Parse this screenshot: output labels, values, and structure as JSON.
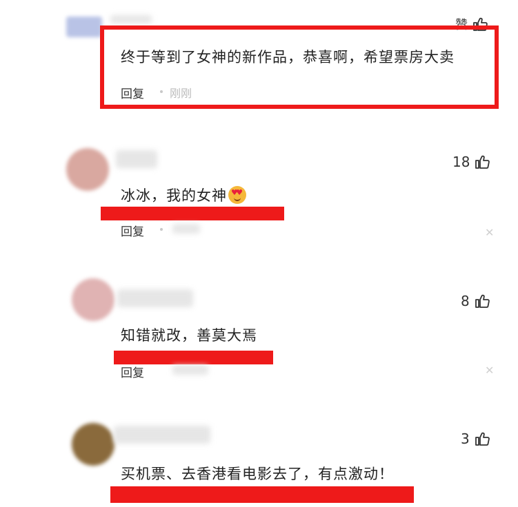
{
  "comments": [
    {
      "text": "终于等到了女神的新作品，恭喜啊，希望票房大卖",
      "likes_label": "赞",
      "reply_label": "回复",
      "time": "刚刚"
    },
    {
      "text": "冰冰，我的女神",
      "emoji": "heart-eyes-emoji",
      "likes": "18",
      "reply_label": "回复"
    },
    {
      "text": "知错就改，善莫大焉",
      "likes": "8",
      "reply_label": "回复"
    },
    {
      "text": "买机票、去香港看电影去了，有点激动！",
      "likes": "3"
    }
  ],
  "colors": {
    "highlight": "#ee1a1a",
    "text": "#222222",
    "muted": "#bbbbbb"
  }
}
